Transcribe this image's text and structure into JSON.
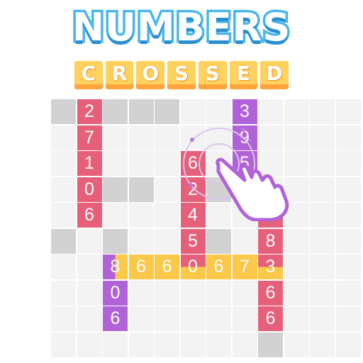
{
  "logo": {
    "line1": "NUMBERS",
    "line2": [
      "C",
      "R",
      "O",
      "S",
      "S",
      "E",
      "D"
    ]
  },
  "board": {
    "rows": 10,
    "cols": 12,
    "colors": {
      "empty": "#f3f3f3",
      "gray": "#d2d2d2",
      "pink": "#e6607a",
      "purple": "#b262d8",
      "yellow": "#fbc84a"
    },
    "gray_cells": [
      [
        0,
        0
      ],
      [
        0,
        2
      ],
      [
        0,
        3
      ],
      [
        0,
        4
      ],
      [
        3,
        2
      ],
      [
        3,
        3
      ],
      [
        3,
        6
      ],
      [
        5,
        0
      ],
      [
        5,
        2
      ],
      [
        5,
        6
      ],
      [
        5,
        8
      ],
      [
        9,
        8
      ]
    ],
    "tiles": [
      {
        "r": 0,
        "c": 1,
        "v": "2",
        "color": "pink"
      },
      {
        "r": 1,
        "c": 1,
        "v": "7",
        "color": "pink"
      },
      {
        "r": 2,
        "c": 1,
        "v": "1",
        "color": "pink"
      },
      {
        "r": 3,
        "c": 1,
        "v": "0",
        "color": "pink"
      },
      {
        "r": 4,
        "c": 1,
        "v": "6",
        "color": "pink"
      },
      {
        "r": 0,
        "c": 7,
        "v": "3",
        "color": "purple"
      },
      {
        "r": 1,
        "c": 7,
        "v": "9",
        "color": "purple"
      },
      {
        "r": 2,
        "c": 7,
        "v": "5",
        "color": "purple"
      },
      {
        "r": 2,
        "c": 5,
        "v": "6",
        "color": "pink"
      },
      {
        "r": 3,
        "c": 5,
        "v": "2",
        "color": "pink"
      },
      {
        "r": 4,
        "c": 5,
        "v": "4",
        "color": "pink"
      },
      {
        "r": 5,
        "c": 5,
        "v": "5",
        "color": "pink"
      },
      {
        "r": 6,
        "c": 5,
        "v": "0",
        "color": "cross-py"
      },
      {
        "r": 4,
        "c": 8,
        "v": "4",
        "color": "pink"
      },
      {
        "r": 5,
        "c": 8,
        "v": "8",
        "color": "pink"
      },
      {
        "r": 6,
        "c": 8,
        "v": "3",
        "color": "cross-py"
      },
      {
        "r": 7,
        "c": 8,
        "v": "6",
        "color": "pink"
      },
      {
        "r": 8,
        "c": 8,
        "v": "6",
        "color": "pink"
      },
      {
        "r": 6,
        "c": 2,
        "v": "8",
        "color": "cross"
      },
      {
        "r": 6,
        "c": 3,
        "v": "6",
        "color": "yellow"
      },
      {
        "r": 6,
        "c": 4,
        "v": "6",
        "color": "yellow"
      },
      {
        "r": 6,
        "c": 6,
        "v": "6",
        "color": "yellow"
      },
      {
        "r": 6,
        "c": 7,
        "v": "7",
        "color": "yellow"
      },
      {
        "r": 7,
        "c": 2,
        "v": "0",
        "color": "purple"
      },
      {
        "r": 8,
        "c": 2,
        "v": "6",
        "color": "purple"
      }
    ]
  },
  "icons": {
    "hand": "pointing-hand-icon"
  }
}
